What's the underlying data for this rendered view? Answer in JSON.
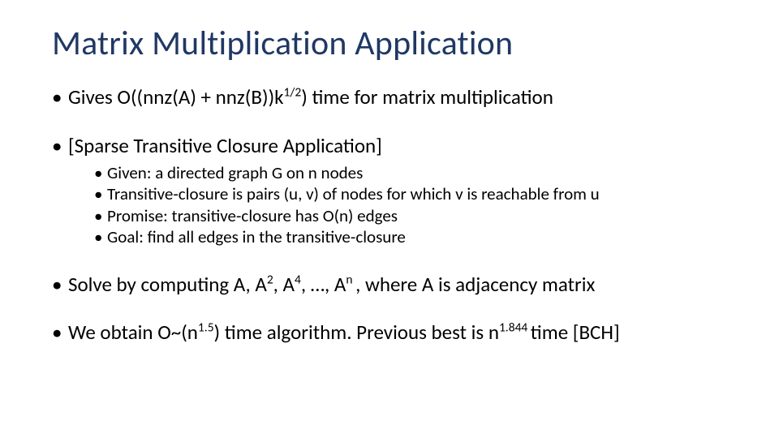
{
  "title": "Matrix Multiplication Application",
  "bullets": {
    "b1": {
      "pre": "Gives O((nnz(A) + nnz(B))k",
      "sup": "1/2",
      "post": ") time for matrix multiplication"
    },
    "b2": "[Sparse Transitive Closure Application]",
    "sub": {
      "s1": "Given: a directed graph G on n nodes",
      "s2": "Transitive-closure is pairs (u, v) of nodes for which v is reachable from u",
      "s3": "Promise: transitive-closure has O(n) edges",
      "s4": "Goal: find all edges in the transitive-closure"
    },
    "b3": {
      "pre": "Solve by computing A, A",
      "sup1": "2",
      "mid1": ", A",
      "sup2": "4",
      "mid2": ", …, A",
      "sup3": "n ",
      "post": ", where A is adjacency matrix"
    },
    "b4": {
      "pre": "We obtain O~(n",
      "sup1": "1.5",
      "mid": ") time algorithm. Previous best is n",
      "sup2": "1.844 ",
      "post": "time [BCH]"
    }
  }
}
